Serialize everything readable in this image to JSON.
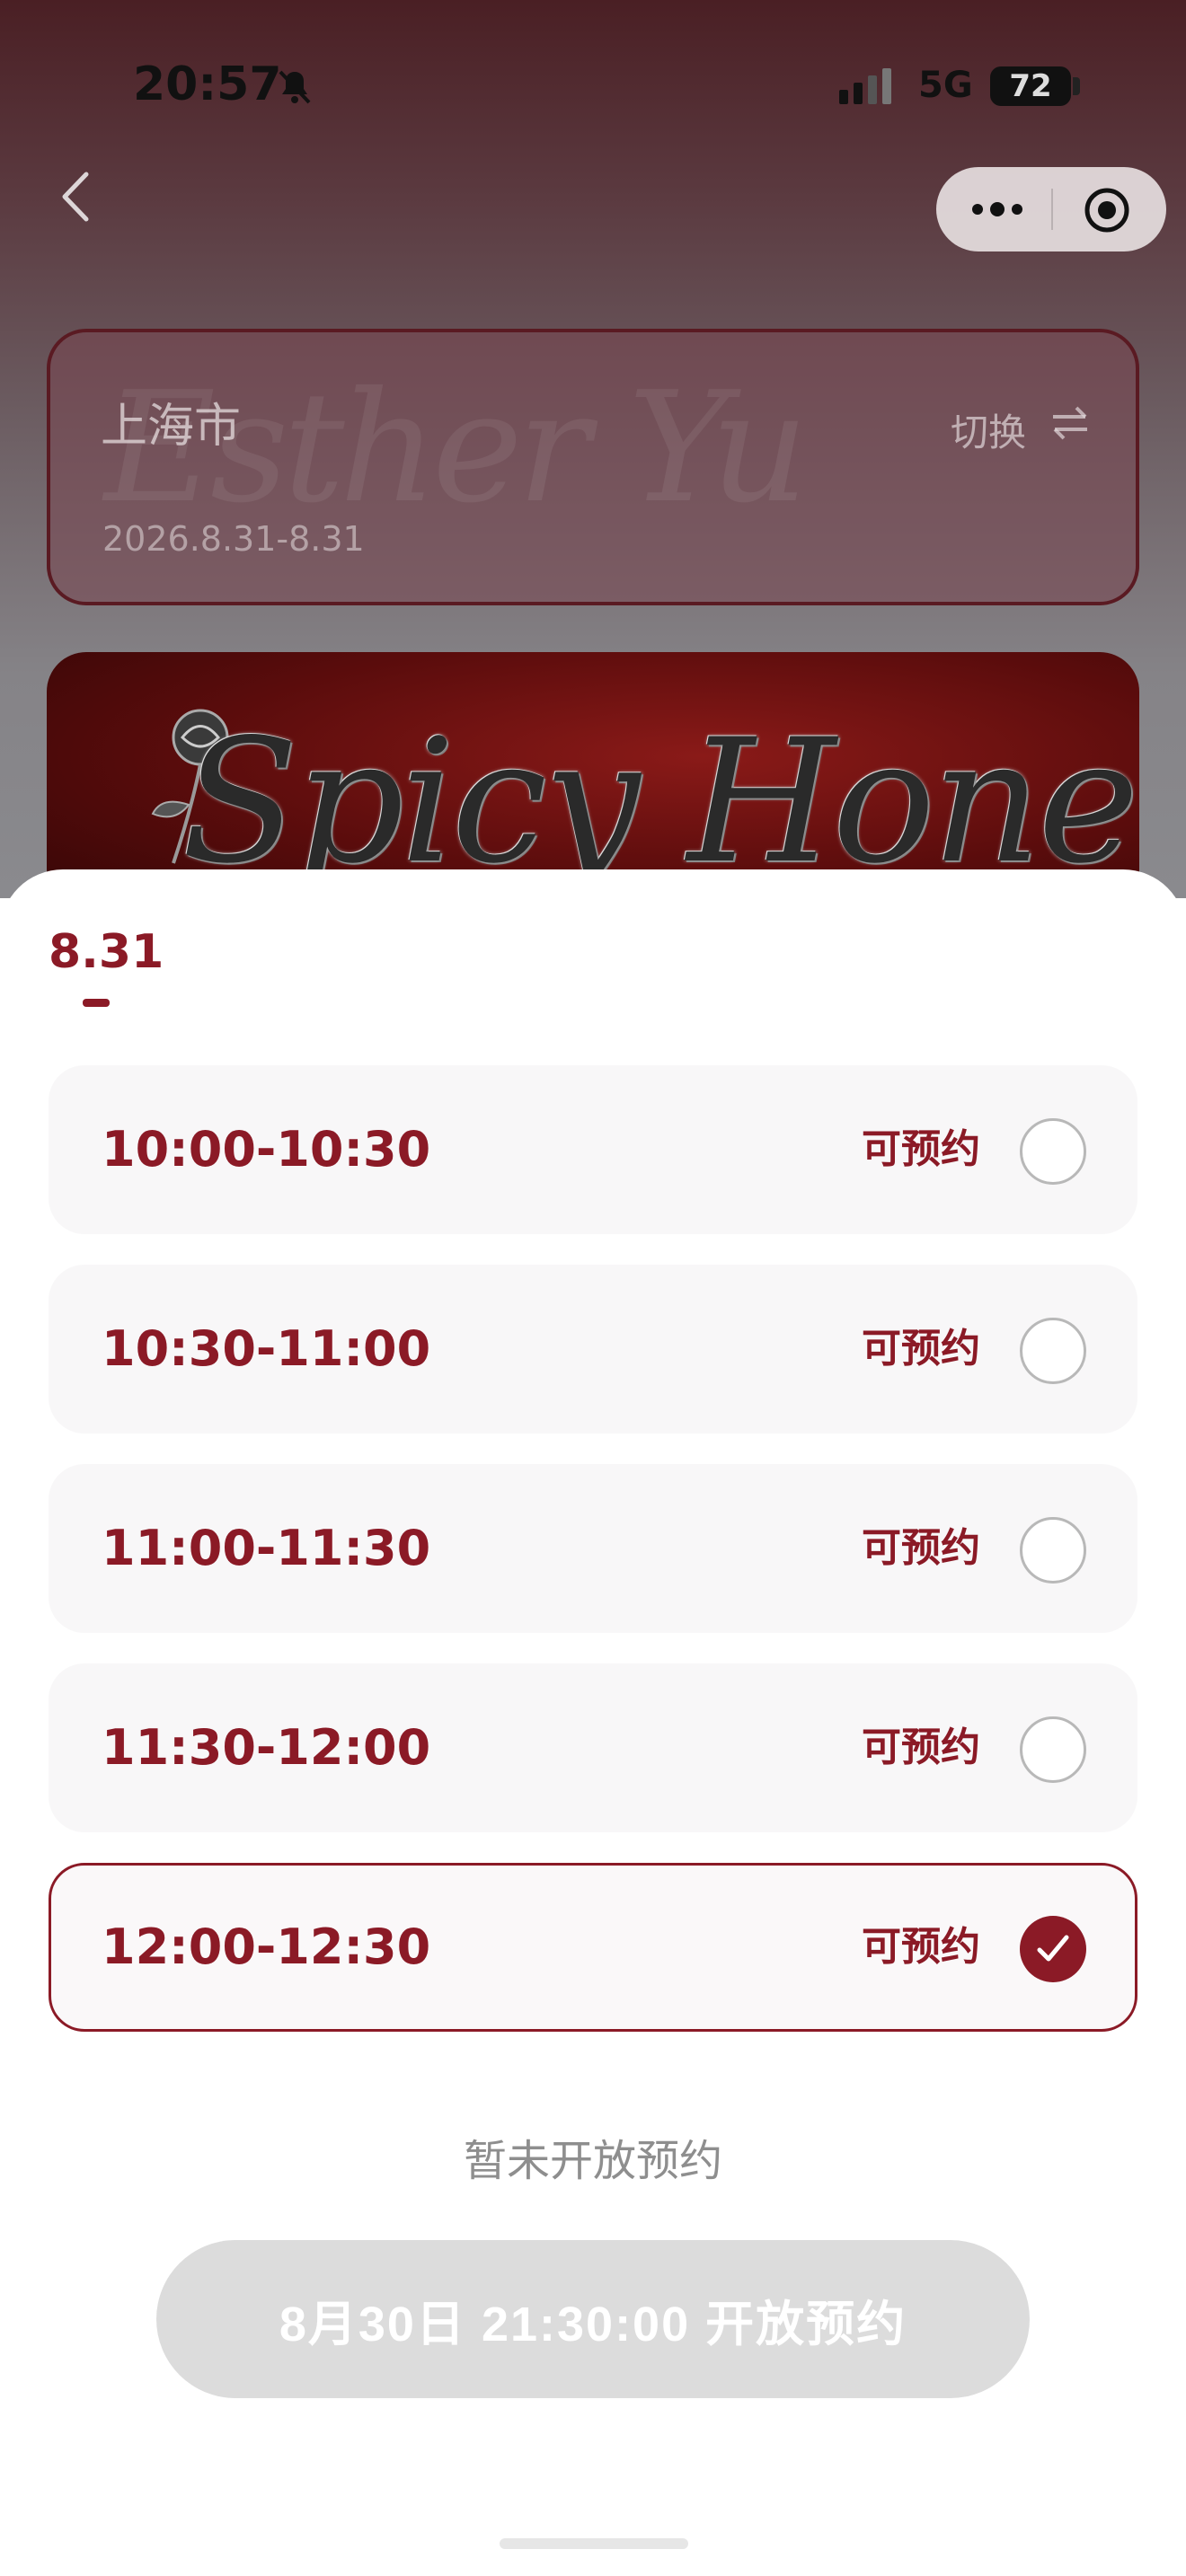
{
  "status_bar": {
    "time": "20:57",
    "network": "5G",
    "battery": "72"
  },
  "header": {
    "back_icon": "chevron-left-icon",
    "more_icon": "more-dots-icon",
    "target_icon": "target-circle-icon"
  },
  "city_card": {
    "city": "上海市",
    "dates": "2026.8.31-8.31",
    "switch_label": "切换",
    "watermark": "Esther Yu"
  },
  "banner": {
    "title": "Spicy Honey"
  },
  "sheet": {
    "date_tab": "8.31",
    "slots": [
      {
        "time": "10:00-10:30",
        "status": "可预约",
        "selected": false
      },
      {
        "time": "10:30-11:00",
        "status": "可预约",
        "selected": false
      },
      {
        "time": "11:00-11:30",
        "status": "可预约",
        "selected": false
      },
      {
        "time": "11:30-12:00",
        "status": "可预约",
        "selected": false
      },
      {
        "time": "12:00-12:30",
        "status": "可预约",
        "selected": true
      }
    ],
    "notice": "暂未开放预约",
    "open_button": "8月30日 21:30:00 开放预约"
  },
  "colors": {
    "accent": "#8b1a26",
    "slot_bg": "#f8f7f8",
    "button_disabled": "#dcdcdc"
  }
}
